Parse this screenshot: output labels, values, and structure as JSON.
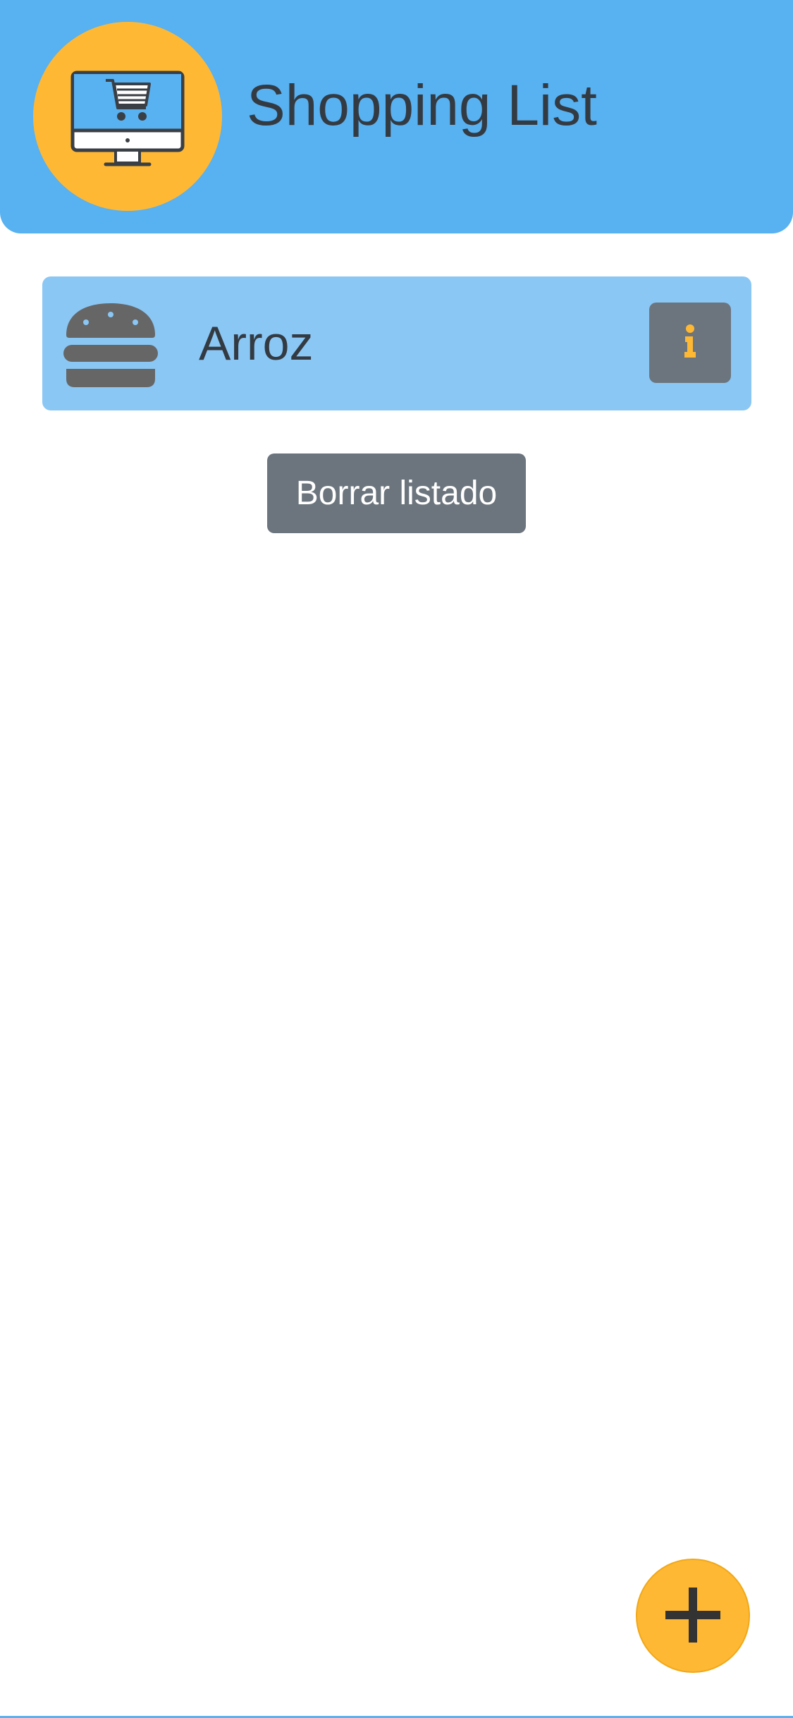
{
  "header": {
    "title": "Shopping List",
    "logo_icon": "computer-shopping-cart-icon",
    "background_color": "#58b1f0"
  },
  "list": {
    "items": [
      {
        "name": "Arroz",
        "icon": "hamburger-icon",
        "info_icon": "info-icon",
        "background_color": "#8ac7f4"
      }
    ]
  },
  "actions": {
    "clear_label": "Borrar listado",
    "add_icon": "plus-icon"
  },
  "colors": {
    "accent": "#ffb833",
    "button_gray": "#6c757d",
    "text_dark": "#333a42"
  }
}
